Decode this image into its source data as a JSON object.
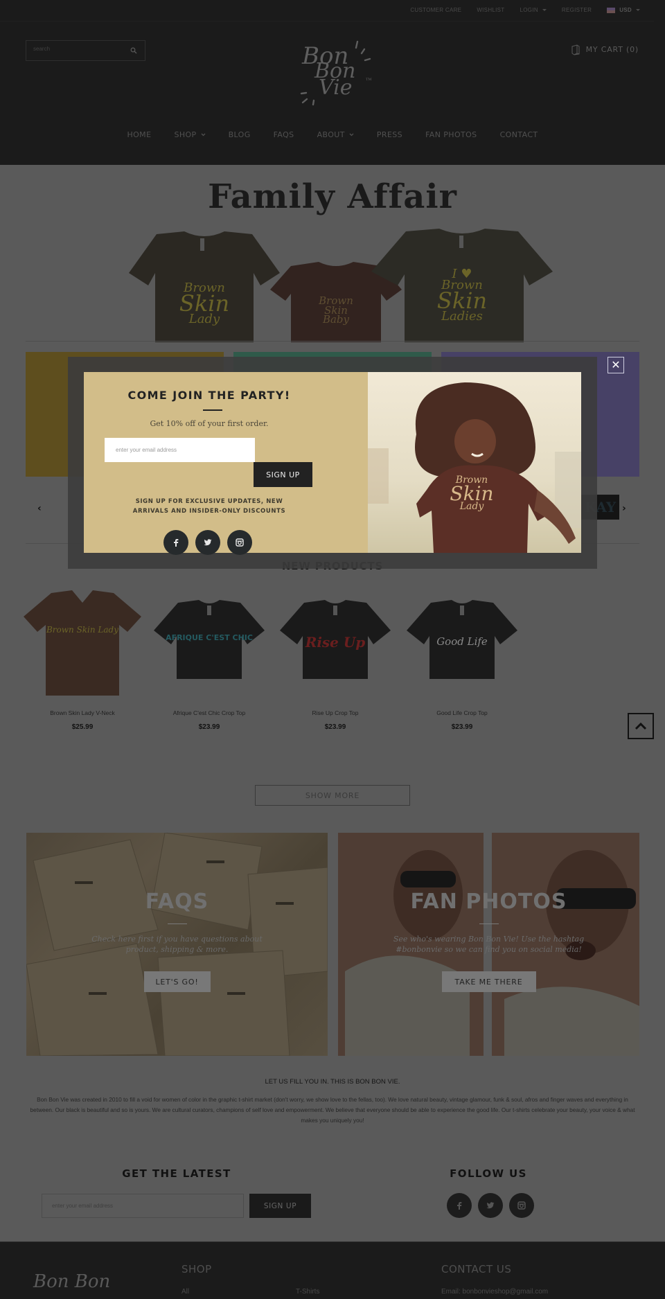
{
  "topbar": {
    "links": [
      "CUSTOMER CARE",
      "WISHLIST",
      "LOGIN",
      "REGISTER"
    ],
    "currency": "USD"
  },
  "search": {
    "placeholder": "search"
  },
  "brand": {
    "logo_line1": "Bon",
    "logo_line2": "Bon",
    "logo_line3": "Vie",
    "tm": "TM"
  },
  "cart": {
    "label": "MY CART (0)"
  },
  "nav": {
    "items": [
      {
        "label": "HOME",
        "dropdown": false
      },
      {
        "label": "SHOP",
        "dropdown": true
      },
      {
        "label": "BLOG",
        "dropdown": false
      },
      {
        "label": "FAQS",
        "dropdown": false
      },
      {
        "label": "ABOUT",
        "dropdown": true
      },
      {
        "label": "PRESS",
        "dropdown": false
      },
      {
        "label": "FAN PHOTOS",
        "dropdown": false
      },
      {
        "label": "CONTACT",
        "dropdown": false
      }
    ]
  },
  "hero": {
    "title": "Family Affair",
    "shirts": [
      {
        "line1": "Brown",
        "line2": "Skin",
        "line3": "Lady"
      },
      {
        "line1": "Brown",
        "line2": "Skin",
        "line3": "Baby"
      },
      {
        "line1": "I ♥",
        "line2": "Brown",
        "line3": "Skin",
        "line4": "Ladies"
      }
    ]
  },
  "slider": {
    "badge_text": "KAY",
    "tile_colors": [
      "#5e4e1e",
      "#2f5a4a",
      "#474166"
    ]
  },
  "popup": {
    "title": "COME JOIN THE PARTY!",
    "subtitle": "Get 10% off of your first order.",
    "email_placeholder": "enter your email address",
    "signup_label": "SIGN UP",
    "fine_print_line1": "SIGN UP FOR EXCLUSIVE UPDATES, NEW",
    "fine_print_line2": "ARRIVALS AND INSIDER-ONLY DISCOUNTS",
    "photo_shirt_line1": "Brown",
    "photo_shirt_line2": "Skin",
    "photo_shirt_line3": "Lady",
    "close_label": "✕",
    "social": [
      "facebook",
      "twitter",
      "instagram"
    ]
  },
  "new_products": {
    "title": "NEW PRODUCTS",
    "items": [
      {
        "name": "Brown Skin Lady V-Neck",
        "price": "$25.99",
        "print": "Brown Skin Lady",
        "shirt_color": "#3a2a22",
        "print_color": "#6b6428"
      },
      {
        "name": "Afrique C'est Chic Crop Top",
        "price": "$23.99",
        "print": "AFRIQUE C'EST CHIC",
        "shirt_color": "#1a1a1a",
        "print_color": "#245a60"
      },
      {
        "name": "Rise Up Crop Top",
        "price": "$23.99",
        "print": "Rise Up",
        "shirt_color": "#1a1a1a",
        "print_color": "#6a1e1e"
      },
      {
        "name": "Good Life Crop Top",
        "price": "$23.99",
        "print": "Good Life",
        "shirt_color": "#1a1a1a",
        "print_color": "#8a8a8a"
      }
    ],
    "show_more_label": "SHOW MORE"
  },
  "panels": {
    "faqs": {
      "title": "FAQS",
      "text": "Check here first if you have questions about product, shipping & more.",
      "button": "LET'S GO!"
    },
    "fan_photos": {
      "title": "FAN PHOTOS",
      "text": "See who's wearing Bon Bon Vie! Use the hashtag #bonbonvie so we can find you on social media!",
      "button": "TAKE ME THERE"
    }
  },
  "about": {
    "title": "LET US FILL YOU IN. THIS IS BON BON VIE.",
    "text": "Bon Bon Vie was created in 2010 to fill a void for women of color in the graphic t-shirt market (don't worry, we show love to the fellas, too). We love natural beauty, vintage glamour, funk & soul, afros and finger waves and everything in between. Our black is beautiful and so is yours. We are cultural curators, champions of self love and empowerment. We believe that everyone should be able to experience the good life. Our t-shirts celebrate your beauty, your voice & what makes you uniquely you!"
  },
  "newsletter": {
    "title": "GET THE LATEST",
    "email_placeholder": "enter your email address",
    "signup_label": "SIGN UP"
  },
  "follow": {
    "title": "FOLLOW US",
    "social": [
      "facebook",
      "twitter",
      "instagram"
    ]
  },
  "footer": {
    "logo": "Bon Bon",
    "shop_heading": "SHOP",
    "shop_links": [
      "All",
      "T-Shirts"
    ],
    "contact_heading": "CONTACT US",
    "email_line": "Email: bonbonvieshop@gmail.com"
  }
}
